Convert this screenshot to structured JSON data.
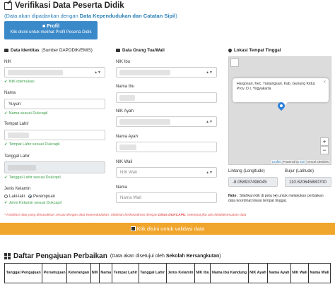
{
  "page": {
    "title": "Verifikasi Data Peserta Didik",
    "subtitle_pre": "(Data akan dipadankan dengan ",
    "subtitle_bold": "Data Kependudukan dan Catatan Sipil",
    "subtitle_post": ")"
  },
  "profil_button": {
    "title": "Profil",
    "subtitle": "Klik disini untuk melihat Profil Peserta Didik"
  },
  "identitas": {
    "heading": "Data Identitas",
    "heading_source": "(Sumber DAPODIK/EMIS)",
    "nik_label": "NIK",
    "nik_status": "NIK ditemukan",
    "nama_label": "Nama",
    "nama_value": "Yuyun",
    "nama_status": "Nama sesuai Dukcapil",
    "tempat_label": "Tempat Lahir",
    "tempat_status": "Tempat Lahir sesuai Dukcapil",
    "tanggal_label": "Tanggal Lahir",
    "tanggal_status": "Tanggal Lahir sesuai Dukcapil",
    "jk_label": "Jenis Kelamin",
    "jk_option_l": "Laki-laki",
    "jk_option_p": "Perempuan",
    "jk_status": "Jenis Kelamin sesuai Dukcapil"
  },
  "orangtua": {
    "heading": "Data Orang Tua/Wali",
    "nik_ibu_label": "NIK Ibu",
    "nama_ibu_label": "Nama Ibu",
    "nik_ayah_label": "NIK Ayah",
    "nama_ayah_label": "Nama Ayah",
    "nik_wali_label": "NIK Wali",
    "nik_wali_placeholder": "NIK Wali",
    "nama_label": "Nama",
    "nama_wali_placeholder": "Nama Wali"
  },
  "lokasi": {
    "heading": "Lokasi Tempat Tinggal",
    "popup_text": "Hargosari, Kec. Tanjungsari, Kab. Gunung Kidul, Prov. D.I. Yogyakarta",
    "popup_close": "×",
    "zoom_in": "+",
    "zoom_out": "−",
    "attrib_leaflet": "Leaflet",
    "attrib_mid": " | Powered by ",
    "attrib_esri": "Esri",
    "attrib_post": " | Vexcel Identities",
    "lintang_label": "Lintang (Longitude)",
    "lintang_value": "-8.058937498045",
    "bujur_label": "Bujur (Latitude)",
    "bujur_value": "110.620645880700",
    "note_bold": "Note",
    "note_text": " : Silahkan klik di peta (",
    "note_text2": ") untuk melakukan perbaikan data koordinat lokasi tempat tinggal."
  },
  "info_line_pre": "* Fasilitasi data yang dimasukkan sesuai dengan data Kependudukan. Silahkan berkoordinasi dengan ",
  "info_line_bold": "Dinas DUKCAPIL",
  "info_line_post": " setempat jika ada ketidaksesuaian data",
  "validasi_label": "Klik disini untuk validasi data",
  "perbaikan": {
    "title": "Daftar Pengajuan Perbaikan",
    "note_pre": "(Data akan disetujui oleh ",
    "note_bold": "Sekolah Bersangkutan",
    "note_post": ")",
    "columns": [
      "Tanggal Pengajuan",
      "Persetujuan",
      "Keterangan",
      "NIK",
      "Nama",
      "Tempat Lahir",
      "Tanggal Lahir",
      "Jenis Kelamin",
      "NIK Ibu",
      "Nama Ibu Kandung",
      "NIK Ayah",
      "Nama Ayah",
      "NIK Wali",
      "Nama Wali"
    ]
  }
}
